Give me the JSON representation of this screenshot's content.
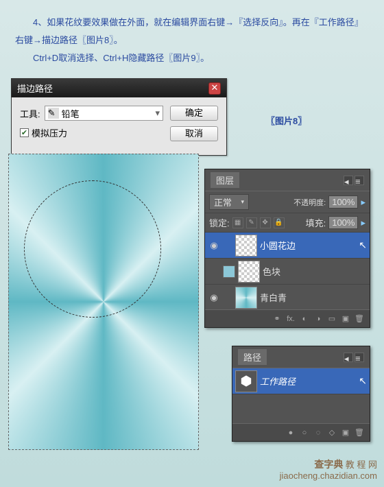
{
  "instruction": {
    "line1": "　　4、如果花纹要效果做在外面，就在编辑界面右键→『选择反向』。再在『工作路径』右键→描边路径〖图片8〗。",
    "line2": "　　Ctrl+D取消选择、Ctrl+H隐藏路径〖图片9〗。"
  },
  "figure8_label": "〖图片8〗",
  "dialog": {
    "title": "描边路径",
    "tool_label": "工具:",
    "tool_value": "铅笔",
    "simulate_pressure": "模拟压力",
    "ok": "确定",
    "cancel": "取消"
  },
  "layers_panel": {
    "tab": "图层",
    "blend_mode": "正常",
    "opacity_label": "不透明度:",
    "opacity_value": "100%",
    "lock_label": "锁定:",
    "fill_label": "填充:",
    "fill_value": "100%",
    "layers": [
      {
        "name": "小圆花边",
        "selected": true
      },
      {
        "name": "色块",
        "selected": false
      },
      {
        "name": "青白青",
        "selected": false
      }
    ]
  },
  "paths_panel": {
    "tab": "路径",
    "path_name": "工作路径"
  },
  "watermark": {
    "brand": "查字典",
    "sub": "教 程 网",
    "url": "jiaocheng.chazidian.com"
  }
}
